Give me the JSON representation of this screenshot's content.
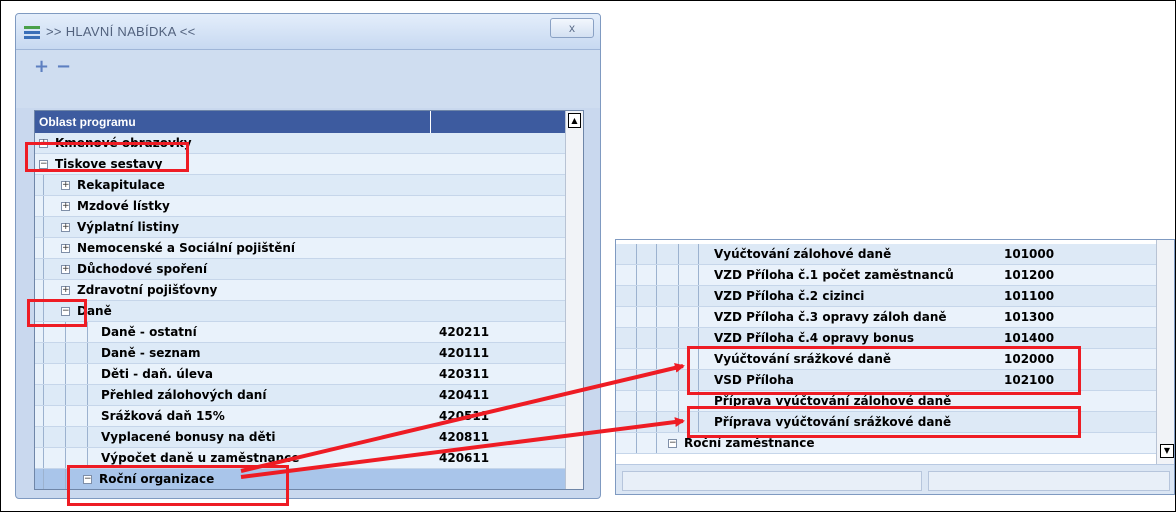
{
  "window": {
    "title": ">> HLAVNÍ NABÍDKA <<",
    "close_label": "x"
  },
  "toolbar": {
    "expand_icon": "plus-icon",
    "collapse_icon": "minus-icon"
  },
  "grid": {
    "header": "Oblast programu",
    "rows": [
      {
        "label": "Kmenové obrazovky",
        "code": ""
      },
      {
        "label": "Tiskove sestavy",
        "code": ""
      },
      {
        "label": "Rekapitulace",
        "code": ""
      },
      {
        "label": "Mzdové lístky",
        "code": ""
      },
      {
        "label": "Výplatní listiny",
        "code": ""
      },
      {
        "label": "Nemocenské a Sociální pojištění",
        "code": ""
      },
      {
        "label": "Důchodové spoření",
        "code": ""
      },
      {
        "label": "Zdravotní pojišťovny",
        "code": ""
      },
      {
        "label": "Daně",
        "code": ""
      },
      {
        "label": "Daně - ostatní",
        "code": "420211"
      },
      {
        "label": "Daně - seznam",
        "code": "420111"
      },
      {
        "label": "Děti - daň. úleva",
        "code": "420311"
      },
      {
        "label": "Přehled zálohových daní",
        "code": "420411"
      },
      {
        "label": "Srážková daň 15%",
        "code": "420511"
      },
      {
        "label": "Vyplacené bonusy na děti",
        "code": "420811"
      },
      {
        "label": "Výpočet daně u zaměstnance",
        "code": "420611"
      },
      {
        "label": "Roční organizace",
        "code": ""
      }
    ]
  },
  "detail": {
    "rows": [
      {
        "label": "Vyúčtování zálohové daně",
        "code": "101000"
      },
      {
        "label": "VZD Příloha č.1 počet zaměstnanců",
        "code": "101200"
      },
      {
        "label": "VZD Příloha č.2 cizinci",
        "code": "101100"
      },
      {
        "label": "VZD Příloha č.3 opravy záloh daně",
        "code": "101300"
      },
      {
        "label": "VZD Příloha č.4 opravy bonus",
        "code": "101400"
      },
      {
        "label": "Vyúčtování srážkové daně",
        "code": "102000"
      },
      {
        "label": "VSD Příloha",
        "code": "102100"
      },
      {
        "label": "Příprava vyúčtování zálohové daně",
        "code": ""
      },
      {
        "label": "Příprava vyúčtování srážkové daně",
        "code": ""
      },
      {
        "label": "Roční zaměstnance",
        "code": ""
      }
    ]
  },
  "colors": {
    "highlight": "#ee1c24",
    "header": "#3d5b9f",
    "row": "#ddeaf7"
  }
}
